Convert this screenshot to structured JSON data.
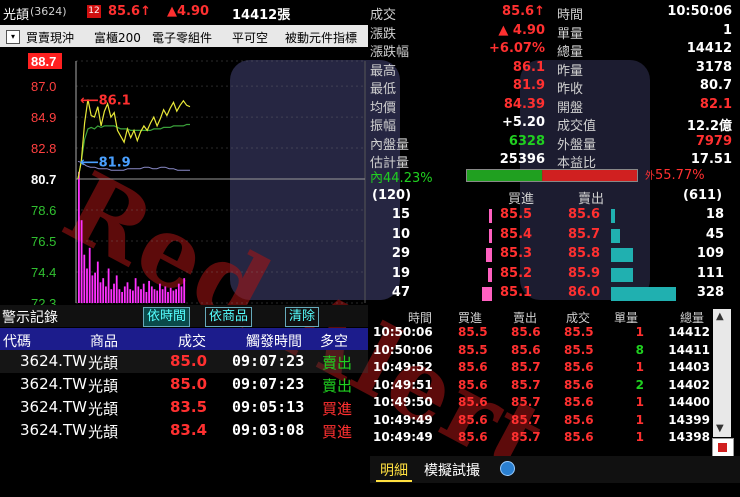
{
  "header": {
    "name": "光頡",
    "code": "(3624)",
    "badge": "12",
    "price": "85.6",
    "price_arrow": "↑",
    "change": "▲4.90",
    "volume": "14412張"
  },
  "toolbar": {
    "items": [
      "買賣現沖",
      "富櫃200",
      "電子零組件",
      "平可空",
      "被動元件指標"
    ]
  },
  "chart": {
    "y_ticks": [
      "88.7",
      "87.0",
      "84.9",
      "82.8",
      "80.7",
      "78.6",
      "76.5",
      "74.4",
      "72.3"
    ],
    "high_label": "86.1",
    "low_label": "81.9",
    "ref_price": 80.7,
    "ylim": [
      72.3,
      88.7
    ],
    "price": [
      80.7,
      81.9,
      84.5,
      86.1,
      85.0,
      84.9,
      85.6,
      84.3,
      85.3,
      85.8,
      84.9,
      85.2,
      84.0,
      83.6,
      83.2,
      84.1,
      83.5,
      84.0,
      83.3,
      83.9,
      84.3,
      84.0,
      84.5,
      84.9,
      84.3,
      84.8,
      85.4,
      85.0,
      85.5,
      85.9,
      85.3,
      85.7,
      86.0,
      85.7,
      85.6
    ],
    "avg": [
      80.7,
      81.9,
      83.4,
      84.1,
      84.2,
      84.1,
      84.3,
      84.2,
      84.3,
      84.3,
      84.3,
      84.3,
      84.2,
      84.1,
      84.1,
      84.1,
      84.0,
      84.0,
      84.0,
      84.0,
      84.0,
      84.0,
      84.0,
      84.1,
      84.1,
      84.1,
      84.2,
      84.2,
      84.2,
      84.3,
      84.3,
      84.3,
      84.3,
      84.4,
      84.4
    ],
    "breadth": [
      81.9,
      81.8,
      81.6,
      81.5,
      81.5,
      81.4,
      81.4,
      81.4,
      81.3,
      81.3,
      81.3,
      81.3,
      81.4,
      81.4,
      81.4,
      81.4,
      81.5,
      81.5,
      81.4,
      81.4,
      81.5,
      81.5,
      81.4,
      81.4,
      81.3,
      81.3,
      81.3,
      81.3
    ],
    "volume": [
      95,
      60,
      35,
      25,
      40,
      20,
      22,
      30,
      15,
      18,
      12,
      25,
      10,
      14,
      20,
      10,
      8,
      12,
      15,
      10,
      9,
      18,
      12,
      10,
      14,
      8,
      16,
      12,
      10,
      9,
      14,
      10,
      12,
      8,
      11,
      9,
      10,
      14,
      12,
      18
    ]
  },
  "alerts": {
    "title": "警示記錄",
    "tabs": [
      "依時間",
      "依商品",
      "清除"
    ],
    "columns": [
      "代碼",
      "商品",
      "成交",
      "觸發時間",
      "多空"
    ],
    "rows": [
      {
        "code": "3624.TW",
        "name": "光頡",
        "price": "85.0",
        "time": "09:07:23",
        "side": "賣出"
      },
      {
        "code": "3624.TW",
        "name": "光頡",
        "price": "85.0",
        "time": "09:07:23",
        "side": "賣出"
      },
      {
        "code": "3624.TW",
        "name": "光頡",
        "price": "83.5",
        "time": "09:05:13",
        "side": "買進"
      },
      {
        "code": "3624.TW",
        "name": "光頡",
        "price": "83.4",
        "time": "09:03:08",
        "side": "買進"
      }
    ]
  },
  "quote": {
    "left": [
      {
        "label": "成交",
        "value": "85.6↑",
        "color": "#ff3030"
      },
      {
        "label": "漲跌",
        "value": "▲ 4.90",
        "color": "#ff3030"
      },
      {
        "label": "漲跌幅",
        "value": "+6.07%",
        "color": "#ff3030"
      },
      {
        "label": "最高",
        "value": "86.1",
        "color": "#ff3030"
      },
      {
        "label": "最低",
        "value": "81.9",
        "color": "#ff3030"
      },
      {
        "label": "均價",
        "value": "84.39",
        "color": "#ff3030"
      },
      {
        "label": "振幅",
        "value": "+5.20",
        "color": "#ffffff"
      },
      {
        "label": "內盤量",
        "value": "6328",
        "color": "#20d020"
      },
      {
        "label": "估計量",
        "value": "25396",
        "color": "#ffffff"
      }
    ],
    "right": [
      {
        "label": "時間",
        "value": "10:50:06",
        "color": "#ffffff"
      },
      {
        "label": "單量",
        "value": "1",
        "color": "#ffffff"
      },
      {
        "label": "總量",
        "value": "14412",
        "color": "#ffffff"
      },
      {
        "label": "昨量",
        "value": "3178",
        "color": "#ffffff"
      },
      {
        "label": "昨收",
        "value": "80.7",
        "color": "#ffffff"
      },
      {
        "label": "開盤",
        "value": "82.1",
        "color": "#ff3030"
      },
      {
        "label": "成交值",
        "value": "12.2億",
        "color": "#ffffff"
      },
      {
        "label": "外盤量",
        "value": "7979",
        "color": "#ff3030"
      },
      {
        "label": "本益比",
        "value": "17.51",
        "color": "#ffffff"
      }
    ],
    "inner_label": "內",
    "inner_pct": "44.23%",
    "outer_label": "外",
    "outer_pct": "55.77%",
    "inner_ratio": 0.4423
  },
  "orderbook": {
    "bid_total": "(120)",
    "ask_total": "(611)",
    "bid_header": "買進",
    "ask_header": "賣出",
    "rows": [
      {
        "bid_qty": "15",
        "bid": "85.5",
        "ask": "85.6",
        "ask_qty": "18"
      },
      {
        "bid_qty": "10",
        "bid": "85.4",
        "ask": "85.7",
        "ask_qty": "45"
      },
      {
        "bid_qty": "29",
        "bid": "85.3",
        "ask": "85.8",
        "ask_qty": "109"
      },
      {
        "bid_qty": "19",
        "bid": "85.2",
        "ask": "85.9",
        "ask_qty": "111"
      },
      {
        "bid_qty": "47",
        "bid": "85.1",
        "ask": "86.0",
        "ask_qty": "328"
      }
    ]
  },
  "trades": {
    "columns": [
      "時間",
      "買進",
      "賣出",
      "成交",
      "單量",
      "總量"
    ],
    "rows": [
      {
        "time": "10:50:06",
        "bid": "85.5",
        "ask": "85.6",
        "price": "85.5",
        "qty": "1",
        "total": "14412"
      },
      {
        "time": "10:50:06",
        "bid": "85.5",
        "ask": "85.6",
        "price": "85.5",
        "qty": "8",
        "total": "14411"
      },
      {
        "time": "10:49:52",
        "bid": "85.6",
        "ask": "85.7",
        "price": "85.6",
        "qty": "1",
        "total": "14403"
      },
      {
        "time": "10:49:51",
        "bid": "85.6",
        "ask": "85.7",
        "price": "85.6",
        "qty": "2",
        "total": "14402"
      },
      {
        "time": "10:49:50",
        "bid": "85.6",
        "ask": "85.7",
        "price": "85.6",
        "qty": "1",
        "total": "14400"
      },
      {
        "time": "10:49:49",
        "bid": "85.6",
        "ask": "85.7",
        "price": "85.6",
        "qty": "1",
        "total": "14399"
      },
      {
        "time": "10:49:49",
        "bid": "85.6",
        "ask": "85.7",
        "price": "85.6",
        "qty": "1",
        "total": "14398"
      }
    ]
  },
  "bottom_tabs": [
    "明細",
    "模擬試撮"
  ],
  "watermark": "Red Alert",
  "colors": {
    "up": "#ff3030",
    "down": "#20d020",
    "price_line": "#e8e838",
    "avg_line": "#3aa03a",
    "volume": "#ff30ff",
    "ask_bar": "#20b0b0",
    "bid_bar": "#ff60c0"
  }
}
